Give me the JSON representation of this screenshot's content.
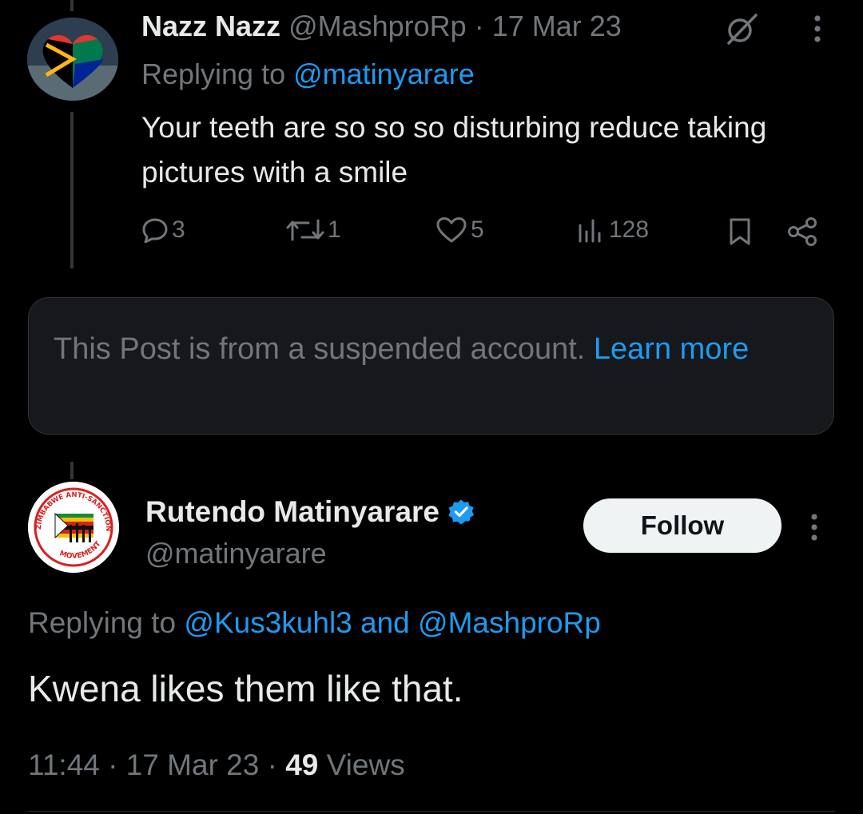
{
  "reply": {
    "display_name": "Nazz Nazz",
    "handle": "@MashproRp",
    "separator": "·",
    "date": "17 Mar 23",
    "replying_prefix": "Replying to",
    "replying_handle": "@matinyarare",
    "text": "Your teeth are so so so disturbing reduce taking pictures with a smile",
    "stats": {
      "replies": "3",
      "reposts": "1",
      "likes": "5",
      "views": "128"
    },
    "icons": [
      "grok-icon",
      "more-icon",
      "reply-icon",
      "repost-icon",
      "like-icon",
      "views-icon",
      "bookmark-icon",
      "share-icon"
    ]
  },
  "suspended_card": {
    "text": "This Post is from a suspended account.",
    "link": "Learn more"
  },
  "main": {
    "display_name": "Rutendo Matinyarare",
    "verified": true,
    "handle": "@matinyarare",
    "follow_label": "Follow",
    "replying_prefix": "Replying to",
    "replying_handles": "@Kus3kuhl3 and @MashproRp",
    "text": "Kwena likes them like that.",
    "time": "11:44",
    "separator": "·",
    "date": "17 Mar 23",
    "views_count": "49",
    "views_label": "Views",
    "avatar_text": {
      "top": "ZIMBABWE ANTI-SANCTIONS",
      "bottom": "MOVEMENT"
    }
  },
  "colors": {
    "background": "#000000",
    "text": "#e7e9ea",
    "muted": "#71767b",
    "link": "#1d9bf0",
    "card": "#16181c",
    "verified": "#1d9bf0"
  }
}
